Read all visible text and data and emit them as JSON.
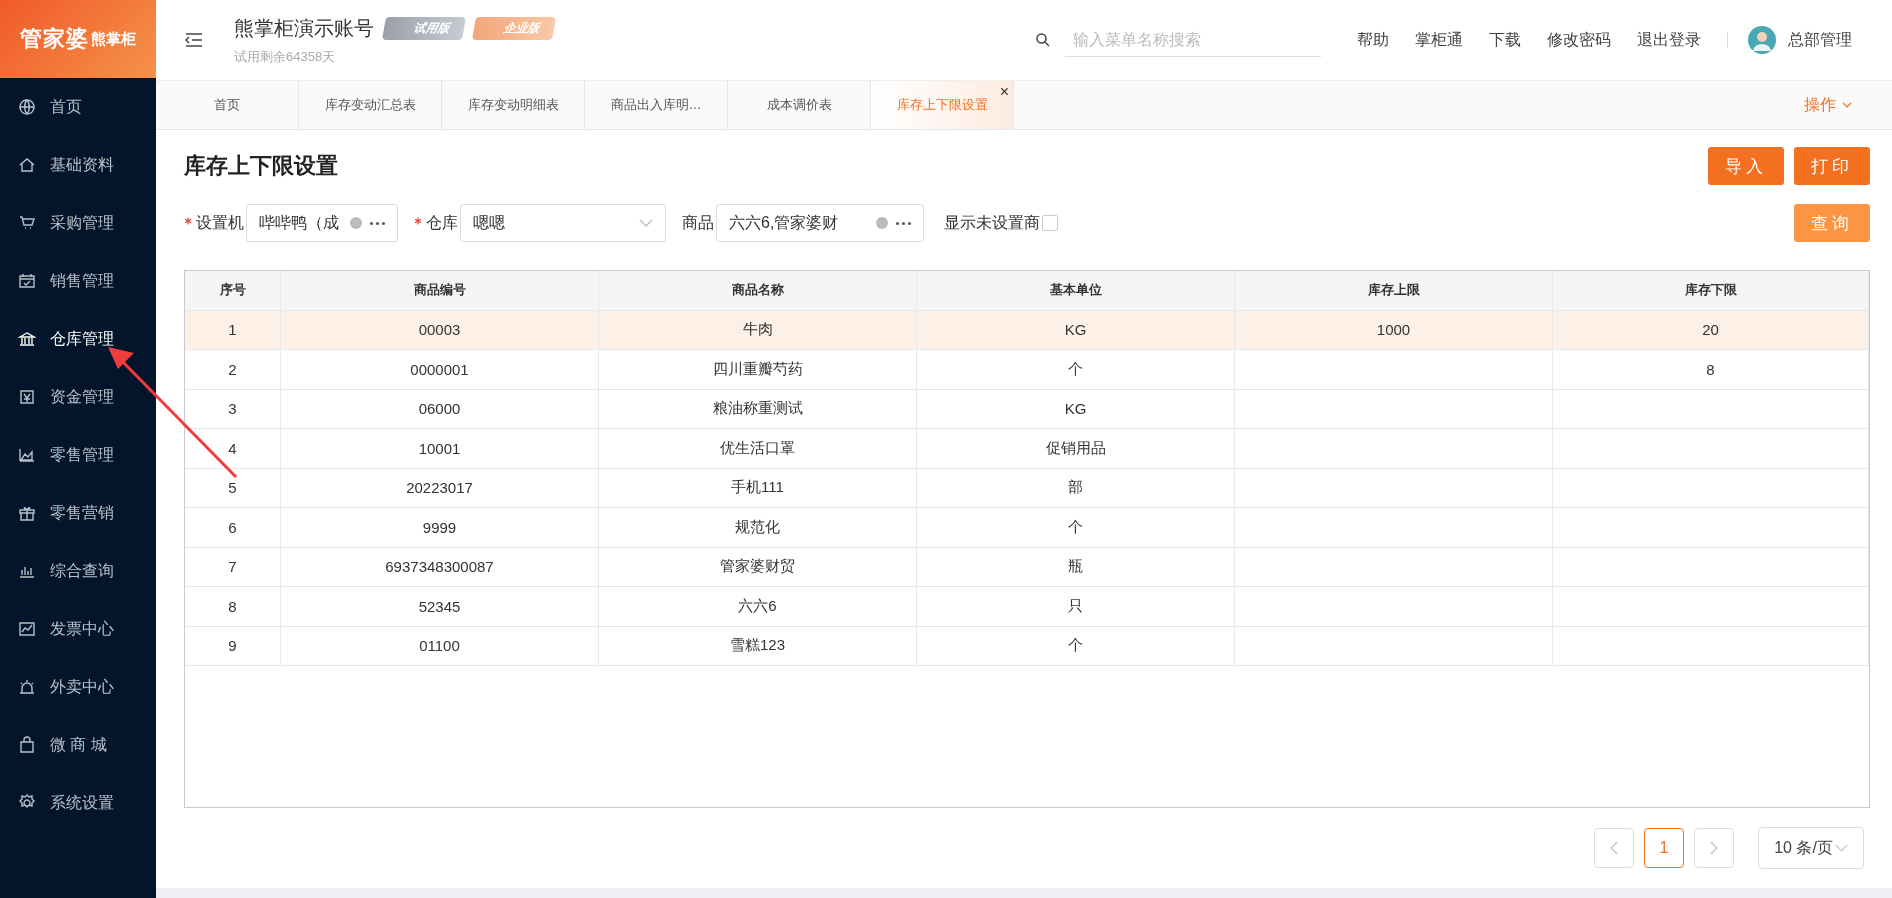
{
  "logo": {
    "brand": "管家婆",
    "sub": "熊掌柜"
  },
  "sidebar": {
    "items": [
      {
        "label": "首页",
        "selected": false
      },
      {
        "label": "基础资料",
        "selected": false
      },
      {
        "label": "采购管理",
        "selected": false
      },
      {
        "label": "销售管理",
        "selected": false
      },
      {
        "label": "仓库管理",
        "selected": true
      },
      {
        "label": "资金管理",
        "selected": false
      },
      {
        "label": "零售管理",
        "selected": false
      },
      {
        "label": "零售营销",
        "selected": false
      },
      {
        "label": "综合查询",
        "selected": false
      },
      {
        "label": "发票中心",
        "selected": false
      },
      {
        "label": "外卖中心",
        "selected": false
      },
      {
        "label": "微 商 城",
        "selected": false
      },
      {
        "label": "系统设置",
        "selected": false
      }
    ]
  },
  "header": {
    "account": "熊掌柜演示账号",
    "badges": [
      "试用版",
      "企业版"
    ],
    "trial": "试用剩余64358天",
    "search": {
      "placeholder": "输入菜单名称搜索"
    },
    "links": [
      "帮助",
      "掌柜通",
      "下载",
      "修改密码",
      "退出登录"
    ],
    "user": "总部管理"
  },
  "tabs": [
    {
      "label": "首页",
      "selected": false
    },
    {
      "label": "库存变动汇总表",
      "selected": false
    },
    {
      "label": "库存变动明细表",
      "selected": false
    },
    {
      "label": "商品出入库明…",
      "selected": false
    },
    {
      "label": "成本调价表",
      "selected": false
    },
    {
      "label": "库存上下限设置",
      "selected": true
    }
  ],
  "tab_close": "×",
  "operations": "操作",
  "page": {
    "title": "库存上下限设置",
    "buttons": [
      "导入",
      "打印"
    ],
    "query_button": "查询"
  },
  "filters": {
    "org": {
      "label": "设置机",
      "required": true,
      "value": "哔哔鸭（成"
    },
    "warehouse": {
      "label": "仓库",
      "required": true,
      "value": "嗯嗯"
    },
    "product": {
      "label": "商品",
      "required": false,
      "value": "六六6,管家婆财"
    },
    "show_unset": {
      "label": "显示未设置商",
      "checked": false
    }
  },
  "table": {
    "columns": [
      "序号",
      "商品编号",
      "商品名称",
      "基本单位",
      "库存上限",
      "库存下限"
    ],
    "rows": [
      {
        "cells": [
          "1",
          "00003",
          "牛肉",
          "KG",
          "1000",
          "20"
        ],
        "selected": true
      },
      {
        "cells": [
          "2",
          "0000001",
          "四川重瓣芍药",
          "个",
          "",
          "8"
        ],
        "selected": false
      },
      {
        "cells": [
          "3",
          "06000",
          "粮油称重测试",
          "KG",
          "",
          ""
        ],
        "selected": false
      },
      {
        "cells": [
          "4",
          "10001",
          "优生活口罩",
          "促销用品",
          "",
          ""
        ],
        "selected": false
      },
      {
        "cells": [
          "5",
          "20223017",
          "手机111",
          "部",
          "",
          ""
        ],
        "selected": false
      },
      {
        "cells": [
          "6",
          "9999",
          "规范化",
          "个",
          "",
          ""
        ],
        "selected": false
      },
      {
        "cells": [
          "7",
          "6937348300087",
          "管家婆财贸",
          "瓶",
          "",
          ""
        ],
        "selected": false
      },
      {
        "cells": [
          "8",
          "52345",
          "六六6",
          "只",
          "",
          ""
        ],
        "selected": false
      },
      {
        "cells": [
          "9",
          "01100",
          "雪糕123",
          "个",
          "",
          ""
        ],
        "selected": false
      }
    ]
  },
  "pagination": {
    "pages": [
      {
        "label": "1",
        "selected": true
      }
    ],
    "page_size": "10 条/页"
  }
}
